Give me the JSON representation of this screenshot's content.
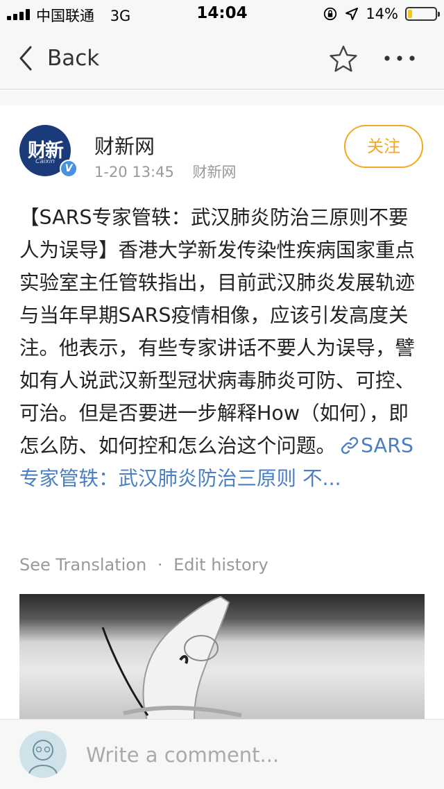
{
  "status_bar": {
    "carrier": "中国联通",
    "network": "3G",
    "time": "14:04",
    "battery_percent": "14%",
    "battery_level": 0.14
  },
  "nav": {
    "back_label": "Back",
    "icons": [
      "chevron-left-icon",
      "star-icon",
      "more-icon"
    ]
  },
  "post": {
    "account_name": "财新网",
    "avatar_text": "财新",
    "avatar_subtext": "Caixin",
    "verified_mark": "V",
    "date": "1-20 13:45",
    "source": "财新网",
    "follow_label": "关注",
    "text": "【SARS专家管轶：武汉肺炎防治三原则不要人为误导】香港大学新发传染性疾病国家重点实验室主任管轶指出，目前武汉肺炎发展轨迹与当年早期SARS疫情相像，应该引发高度关注。他表示，有些专家讲话不要人为误导，譬如有人说武汉新型冠状病毒肺炎可防、可控、可治。但是否要进一步解释How（如何），即怎么防、如何控和怎么治这个问题。",
    "link_text": "SARS专家管轶：武汉肺炎防治三原则 不...",
    "see_translation": "See Translation",
    "separator": "·",
    "edit_history": "Edit history"
  },
  "comment": {
    "placeholder": "Write a comment..."
  },
  "colors": {
    "accent_orange": "#f5a623",
    "link_blue": "#4a7fc4",
    "verified_blue": "#4a90e2",
    "caixin_navy": "#1a3a7a"
  }
}
